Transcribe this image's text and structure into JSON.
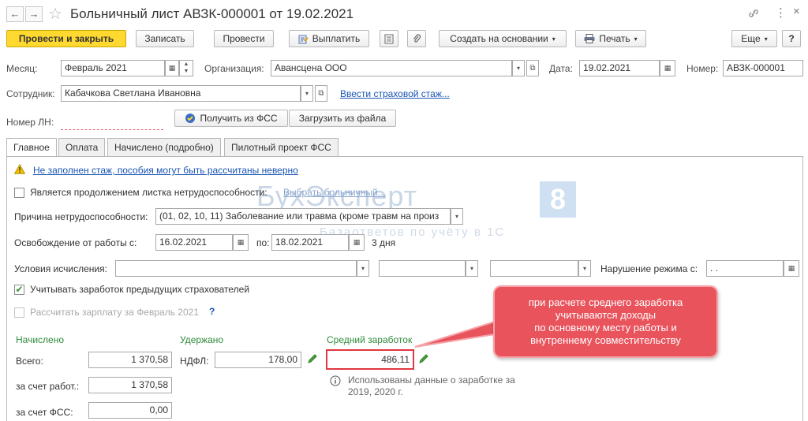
{
  "header": {
    "title": "Больничный лист АВЗК-000001 от 19.02.2021",
    "back_glyph": "←",
    "forward_glyph": "→",
    "star_glyph": "☆",
    "link_glyph": "🔗",
    "menu_glyph": "⋮",
    "close_glyph": "×"
  },
  "toolbar": {
    "post_close": "Провести и закрыть",
    "save": "Записать",
    "post": "Провести",
    "pay": "Выплатить",
    "create_based": "Создать на основании",
    "print": "Печать",
    "more": "Еще",
    "help": "?"
  },
  "form": {
    "month_label": "Месяц:",
    "month_value": "Февраль 2021",
    "org_label": "Организация:",
    "org_value": "Авансцена ООО",
    "date_label": "Дата:",
    "date_value": "19.02.2021",
    "number_label": "Номер:",
    "number_value": "АВЗК-000001",
    "employee_label": "Сотрудник:",
    "employee_value": "Кабачкова Светлана Ивановна",
    "insurance_link": "Ввести страховой стаж...",
    "ln_label": "Номер ЛН:",
    "ln_value": "",
    "get_fss": "Получить из ФСС",
    "load_file": "Загрузить из файла"
  },
  "tabs": [
    {
      "label": "Главное"
    },
    {
      "label": "Оплата"
    },
    {
      "label": "Начислено (подробно)"
    },
    {
      "label": "Пилотный проект ФСС"
    }
  ],
  "main": {
    "warning_link": "Не заполнен стаж, пособия могут быть рассчитаны неверно",
    "continuation_label": "Является продолжением листка нетрудоспособности:",
    "select_sick_link": "Выбрать больничный...",
    "cause_label": "Причина нетрудоспособности:",
    "cause_value": "(01, 02, 10, 11) Заболевание или травма (кроме травм на произ",
    "release_label": "Освобождение от работы с:",
    "release_from": "16.02.2021",
    "to_label": "по:",
    "release_to": "18.02.2021",
    "days_text": "3 дня",
    "conditions_label": "Условия исчисления:",
    "violation_label": "Нарушение режима с:",
    "violation_value": " .  .",
    "consider_prev_label": "Учитывать заработок предыдущих страхователей",
    "calc_salary_label": "Рассчитать зарплату за Февраль 2021",
    "calc_help": "?",
    "accrued_header": "Начислено",
    "withheld_header": "Удержано",
    "avg_header": "Средний заработок",
    "total_label": "Всего:",
    "total_value": "1 370,58",
    "ndfl_label": "НДФЛ:",
    "ndfl_value": "178,00",
    "avg_value": "486,11",
    "employer_label": "за счет работ.:",
    "employer_value": "1 370,58",
    "fss_label": "за счет ФСС:",
    "fss_value": "0,00",
    "info_line1": "Использованы данные о заработке за",
    "info_line2": "2019,  2020 г."
  },
  "callout": {
    "line1": "при расчете среднего заработка",
    "line2": "учитываются доходы",
    "line3": "по основному месту работы и",
    "line4": "внутреннему совместительству"
  },
  "watermark": {
    "brand": "БухЭксперт",
    "badge": "8",
    "tagline": "Базаответов по учёту в 1С"
  },
  "colors": {
    "primary_button": "#ffd930",
    "link": "#1a55b4",
    "accent_green": "#2e8b3a",
    "callout": "#e8535c",
    "highlight_border": "#e0383f"
  }
}
